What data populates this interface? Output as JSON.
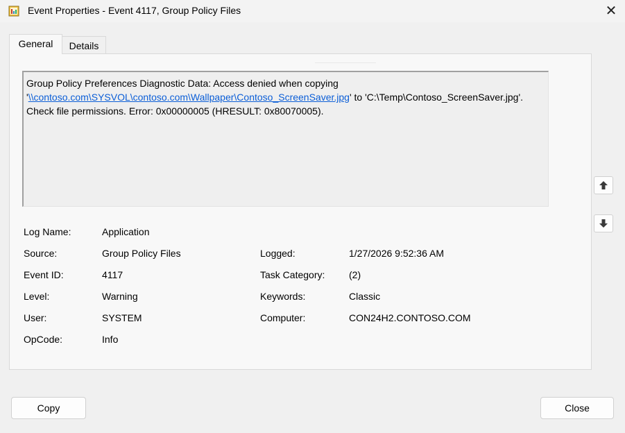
{
  "window": {
    "title": "Event Properties - Event 4117, Group Policy Files",
    "close_glyph": "✕"
  },
  "tabs": [
    {
      "label": "General",
      "selected": true
    },
    {
      "label": "Details",
      "selected": false
    }
  ],
  "description": {
    "text_before": "Group Policy Preferences Diagnostic Data: Access denied when copying '",
    "link_text": "\\\\contoso.com\\SYSVOL\\contoso.com\\Wallpaper\\Contoso_ScreenSaver.jpg",
    "text_after": "' to 'C:\\Temp\\Contoso_ScreenSaver.jpg'. Check file permissions. Error: 0x00000005 (HRESULT: 0x80070005)."
  },
  "fields": {
    "log_name": {
      "label": "Log Name:",
      "value": "Application"
    },
    "source": {
      "label": "Source:",
      "value": "Group Policy Files"
    },
    "event_id": {
      "label": "Event ID:",
      "value": "4117"
    },
    "level": {
      "label": "Level:",
      "value": "Warning"
    },
    "user": {
      "label": "User:",
      "value": "SYSTEM"
    },
    "opcode": {
      "label": "OpCode:",
      "value": "Info"
    },
    "logged": {
      "label": "Logged:",
      "value": "1/27/2026 9:52:36 AM"
    },
    "task_category": {
      "label": "Task Category:",
      "value": "(2)"
    },
    "keywords": {
      "label": "Keywords:",
      "value": "Classic"
    },
    "computer": {
      "label": "Computer:",
      "value": "CON24H2.CONTOSO.COM"
    }
  },
  "nav_buttons": {
    "up_icon": "arrow-up-icon",
    "down_icon": "arrow-down-icon"
  },
  "buttons": {
    "copy": "Copy",
    "close": "Close"
  }
}
